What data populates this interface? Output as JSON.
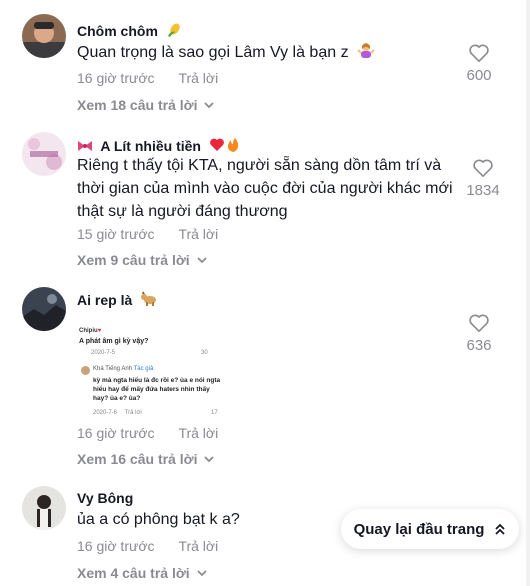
{
  "comments": [
    {
      "username": "Chôm chôm",
      "username_emoji": "corn-emoji",
      "text": "Quan trọng là sao gọi Lâm Vy là bạn z",
      "text_emoji": "woman-shrugging-emoji",
      "time": "16 giờ trước",
      "reply_label": "Trả lời",
      "view_replies": "Xem 18 câu trả lời",
      "likes": "600"
    },
    {
      "username": "A Lít nhiều tiền",
      "username_prefix_emoji": "bow-emoji",
      "username_suffix_emoji": "heart-fire-emoji",
      "text": "Riêng t thấy tội KTA, người sẵn sàng dồn tâm trí và thời gian của mình vào cuộc đời của người khác mới thật sự là người đáng thương",
      "time": "15 giờ trước",
      "reply_label": "Trả lời",
      "view_replies": "Xem 9 câu trả lời",
      "likes": "1834"
    },
    {
      "username": "Ai rep là",
      "username_emoji": "dog-emoji",
      "image": {
        "user1": "Chipiu",
        "text1": "A phát âm gì kỳ vậy?",
        "date1": "2020-7-5",
        "count1": "30",
        "user2": "Khá Tiếng Anh",
        "author_tag": "Tác giả",
        "text2": "kỳ mà ngta hiểu là đc rồi e? ủa e nói ngta hiểu hay để mấy đứa haters nhìn thấy hay? ủa e? ủa?",
        "date2": "2020-7-6",
        "reply2": "Trả lời",
        "count2": "17"
      },
      "time": "16 giờ trước",
      "reply_label": "Trả lời",
      "view_replies": "Xem 16 câu trả lời",
      "likes": "636"
    },
    {
      "username": "Vy Bông",
      "text": "ủa a có phông bạt k a?",
      "time": "16 giờ trước",
      "reply_label": "Trả lời",
      "view_replies": "Xem 4 câu trả lời"
    }
  ],
  "back_to_top": "Quay lại đầu trang",
  "colors": {
    "text": "#161823",
    "muted": "#8a8b91",
    "heart_red": "#e8273b"
  }
}
